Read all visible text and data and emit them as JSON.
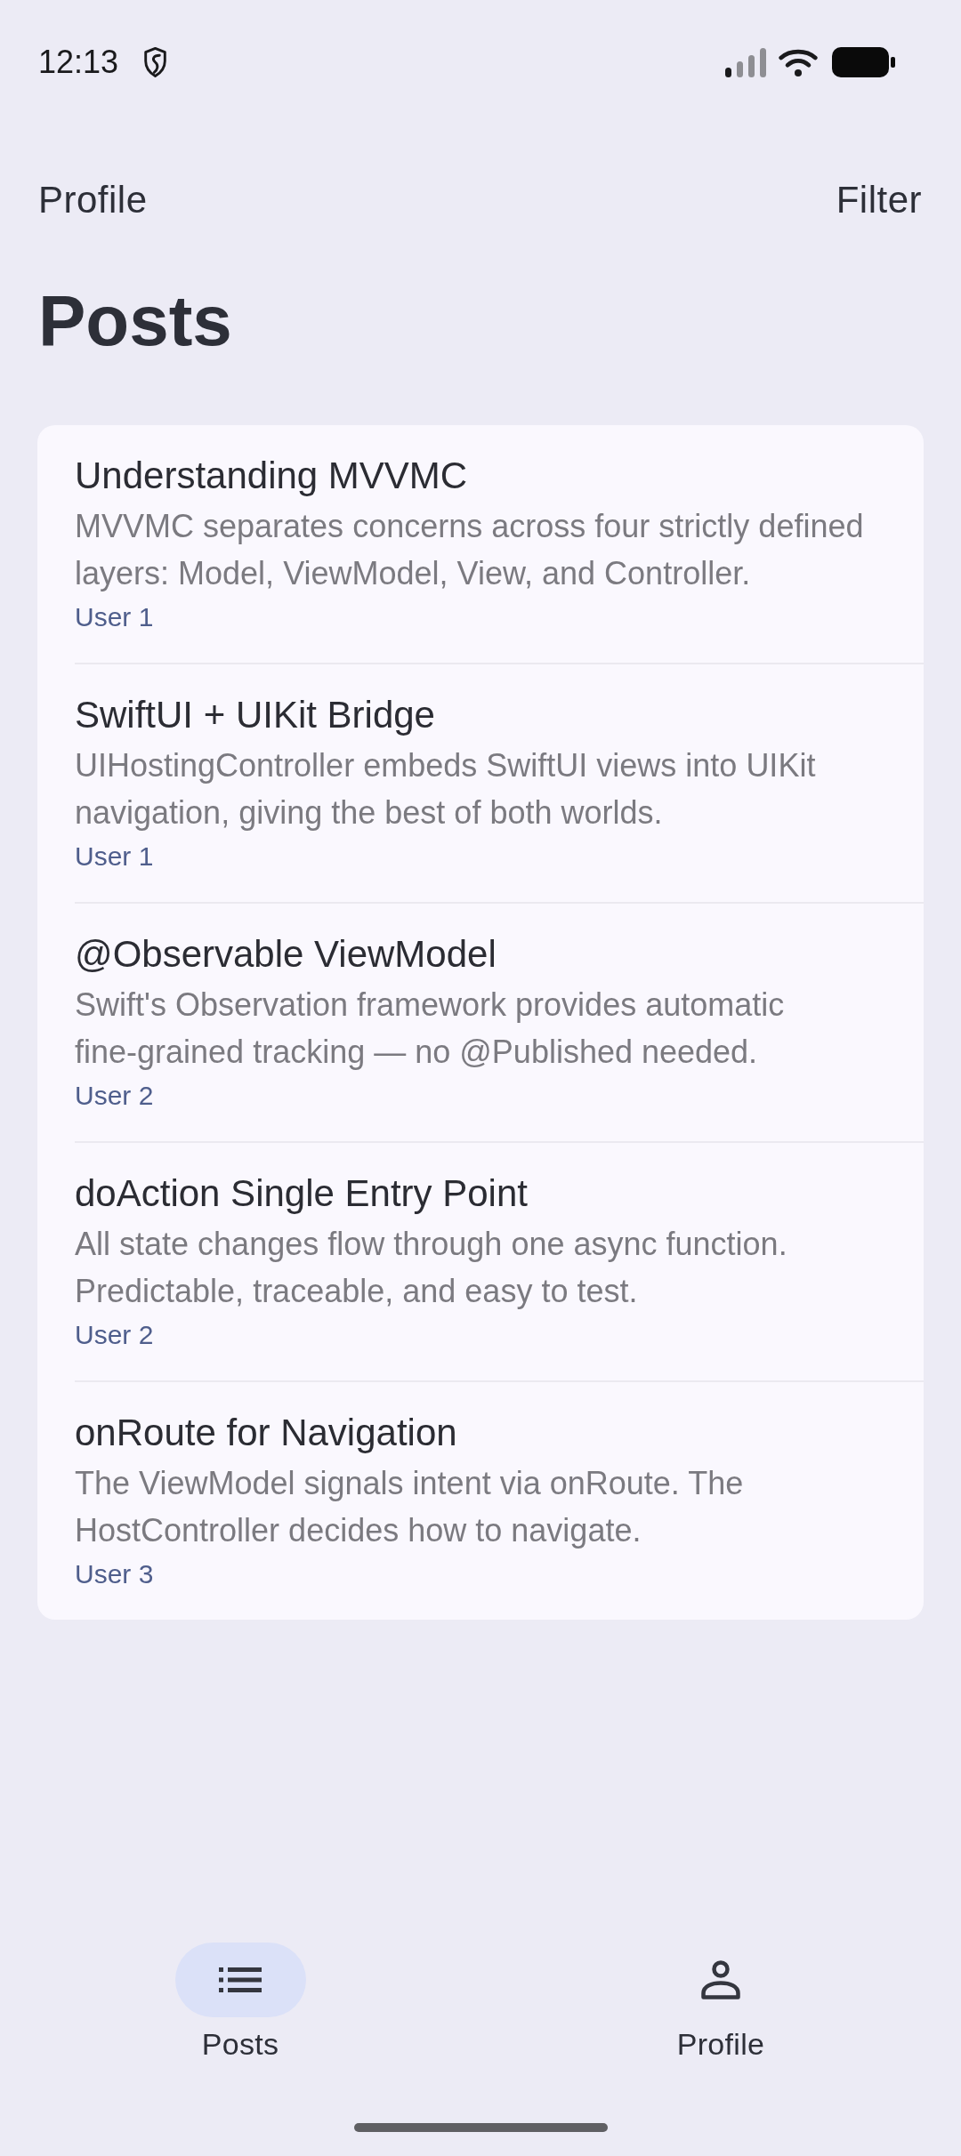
{
  "status_bar": {
    "time": "12:13"
  },
  "header": {
    "left_button": "Profile",
    "right_button": "Filter",
    "title": "Posts"
  },
  "posts": [
    {
      "title": "Understanding MVVMC",
      "body": "MVVMC separates concerns across four strictly defined layers: Model, ViewModel, View, and Controller.",
      "author": "User 1"
    },
    {
      "title": "SwiftUI + UIKit Bridge",
      "body": "UIHostingController embeds SwiftUI views into UIKit navigation, giving the best of both worlds.",
      "author": "User 1"
    },
    {
      "title": "@Observable ViewModel",
      "body": "Swift's Observation framework provides automatic fine-grained tracking — no @Published needed.",
      "author": "User 2"
    },
    {
      "title": "doAction Single Entry Point",
      "body": "All state changes flow through one async function. Predictable, traceable, and easy to test.",
      "author": "User 2"
    },
    {
      "title": "onRoute for Navigation",
      "body": "The ViewModel signals intent via onRoute. The HostController decides how to navigate.",
      "author": "User 3"
    }
  ],
  "bottom_nav": [
    {
      "label": "Posts",
      "selected": true
    },
    {
      "label": "Profile",
      "selected": false
    }
  ]
}
